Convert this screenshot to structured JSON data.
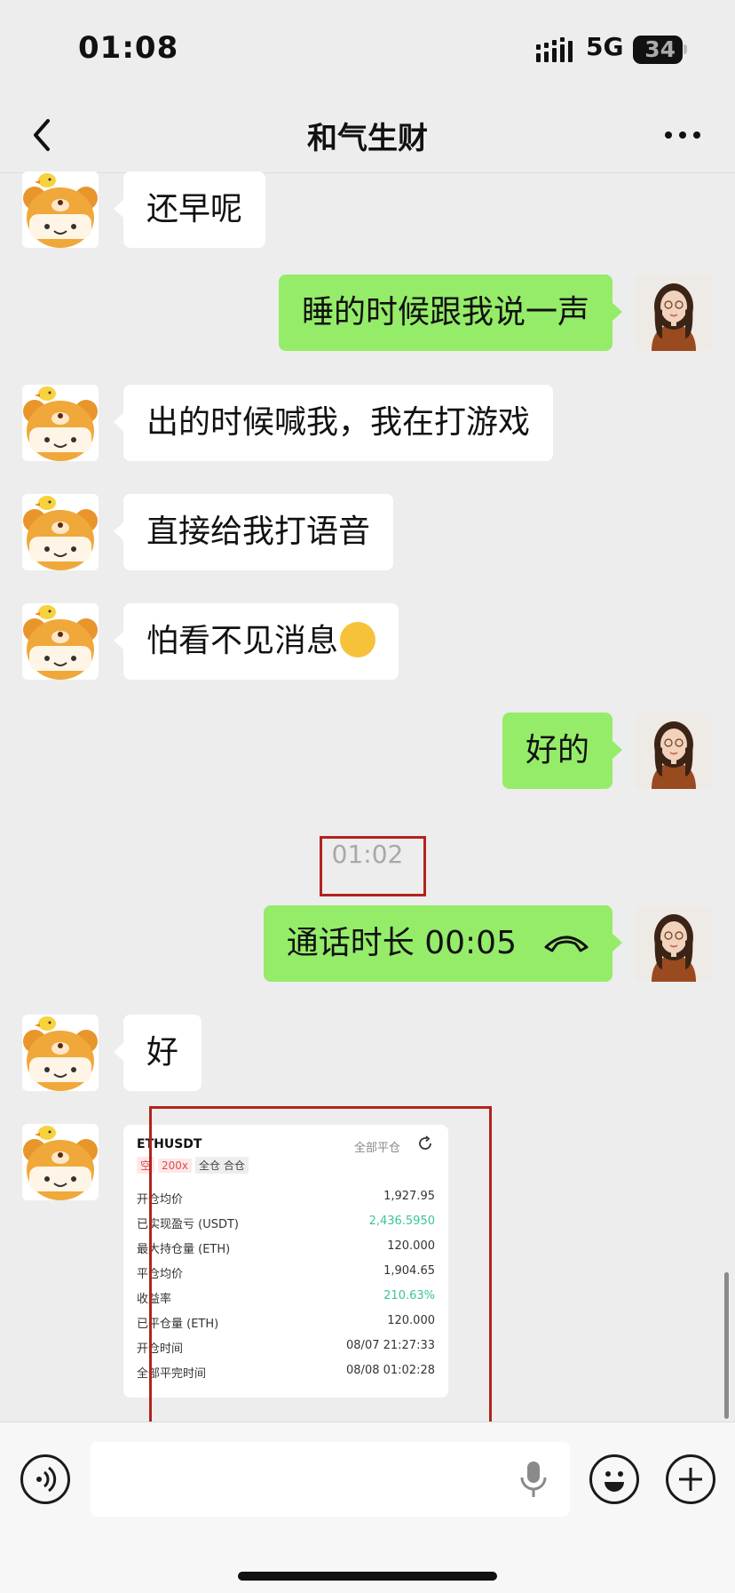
{
  "status_bar": {
    "time": "01:08",
    "network": "5G",
    "battery": "34"
  },
  "header": {
    "title": "和气生财"
  },
  "messages": [
    {
      "side": "in",
      "text": "还早呢"
    },
    {
      "side": "out",
      "text": "睡的时候跟我说一声"
    },
    {
      "side": "in",
      "text": "出的时候喊我，我在打游戏"
    },
    {
      "side": "in",
      "text": "直接给我打语音"
    },
    {
      "side": "in",
      "text": "怕看不见消息"
    },
    {
      "side": "out",
      "text": "好的"
    },
    {
      "side": "out",
      "text": "通话时长 00:05"
    },
    {
      "side": "in",
      "text": "好"
    }
  ],
  "timestamp": "01:02",
  "trade_card": {
    "symbol": "ETHUSDT",
    "close_all": "全部平仓",
    "tags": [
      "空",
      "200x",
      "全仓 合仓"
    ],
    "rows": [
      {
        "label": "开仓均价",
        "value": "1,927.95"
      },
      {
        "label": "已实现盈亏 (USDT)",
        "value": "2,436.5950"
      },
      {
        "label": "最大持仓量 (ETH)",
        "value": "120.000"
      },
      {
        "label": "平仓均价",
        "value": "1,904.65"
      },
      {
        "label": "收益率",
        "value": "210.63%"
      },
      {
        "label": "已平仓量 (ETH)",
        "value": "120.000"
      },
      {
        "label": "开仓时间",
        "value": "08/07 21:27:33"
      },
      {
        "label": "全部平完时间",
        "value": "08/08 01:02:28"
      }
    ]
  },
  "colors": {
    "sent_bubble": "#95ec69",
    "received_bubble": "#ffffff",
    "highlight_box": "#b3231c",
    "profit": "#3cc39d"
  }
}
